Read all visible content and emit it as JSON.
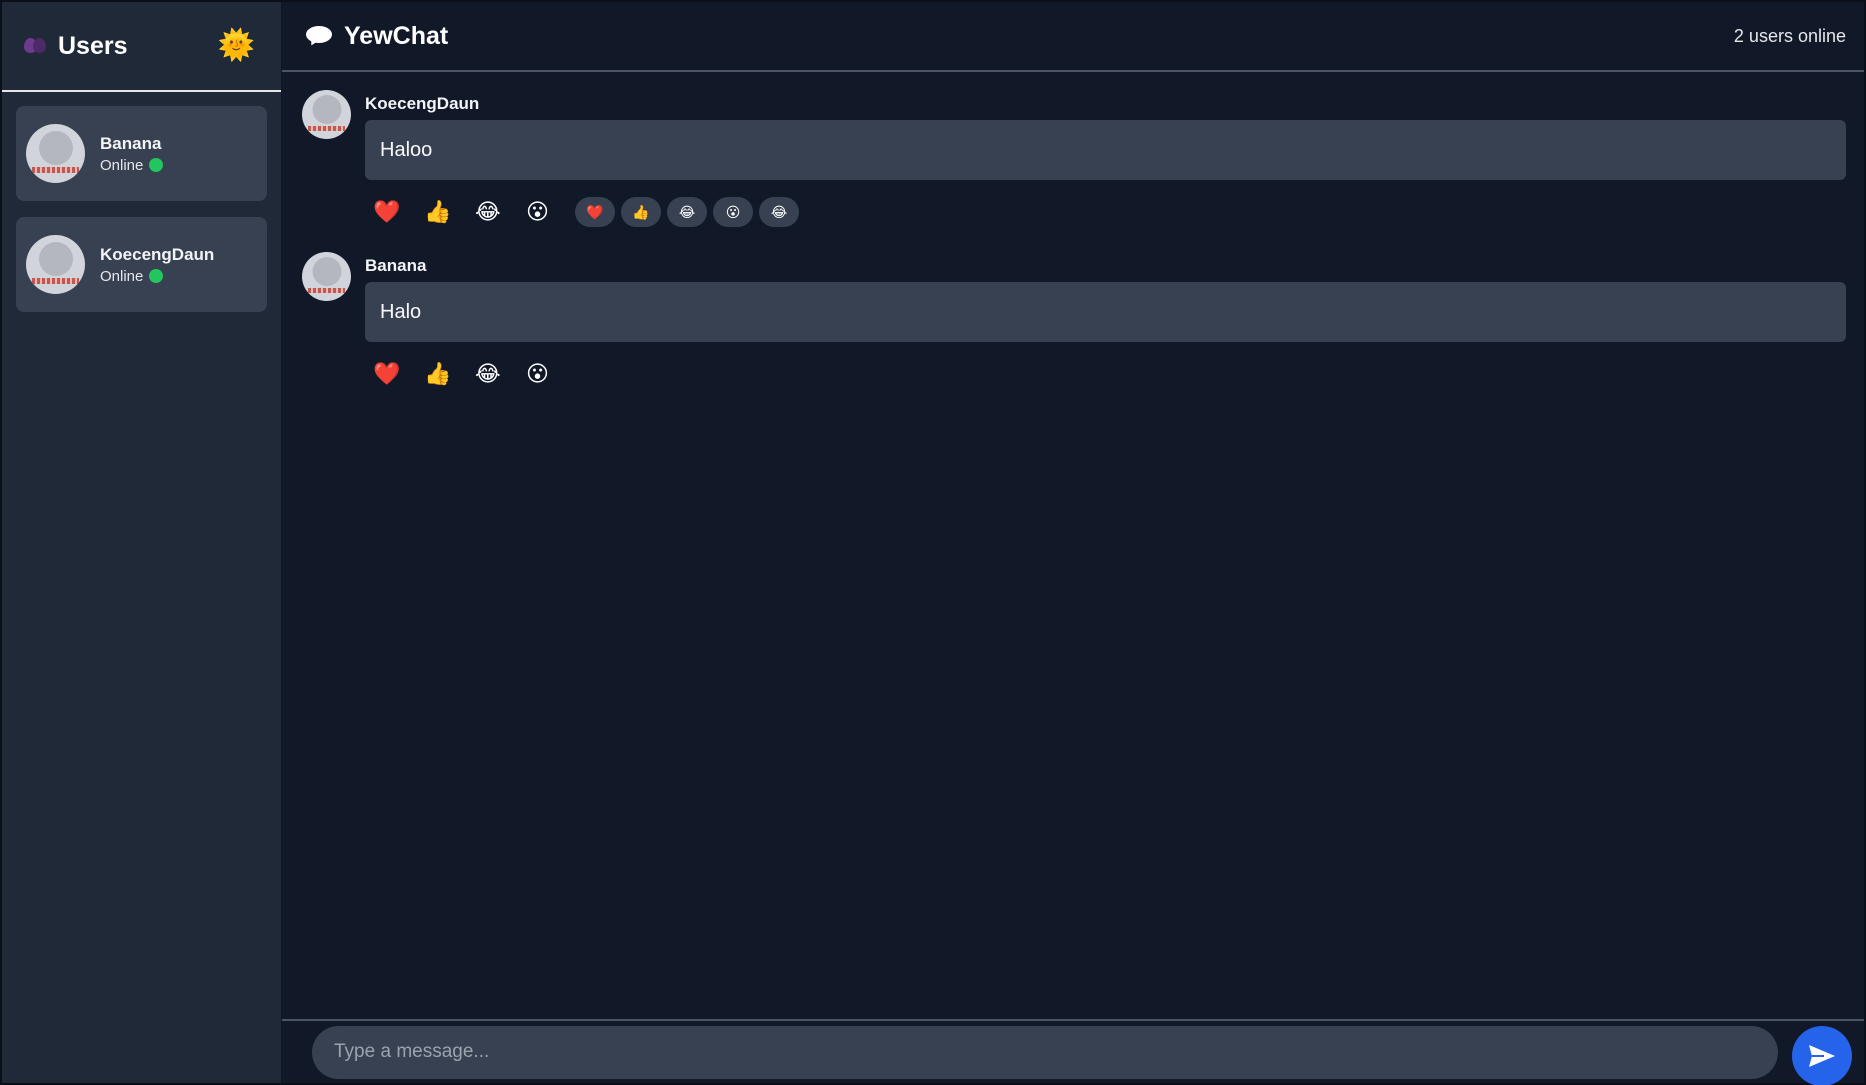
{
  "sidebar": {
    "title": "Users",
    "users": [
      {
        "name": "Banana",
        "status": "Online"
      },
      {
        "name": "KoecengDaun",
        "status": "Online"
      }
    ]
  },
  "header": {
    "title": "YewChat",
    "online_count": "2 users online"
  },
  "messages": [
    {
      "sender": "KoecengDaun",
      "text": "Haloo",
      "reaction_buttons": [
        "❤️",
        "👍",
        "😂",
        "😮"
      ],
      "reaction_pills": [
        "❤️",
        "👍",
        "😂",
        "😮",
        "😂"
      ]
    },
    {
      "sender": "Banana",
      "text": "Halo",
      "reaction_buttons": [
        "❤️",
        "👍",
        "😂",
        "😮"
      ],
      "reaction_pills": []
    }
  ],
  "composer": {
    "placeholder": "Type a message..."
  },
  "icons": {
    "sidebar_title": "purple-hearts-icon",
    "theme_toggle": "sun-icon",
    "header_title": "speech-bubble-icon",
    "send": "paper-plane-icon"
  },
  "colors": {
    "sidebar_bg": "#1f2937",
    "main_bg": "#111827",
    "card_bg": "#374151",
    "online_dot": "#22c55e",
    "send_button": "#2563eb"
  }
}
